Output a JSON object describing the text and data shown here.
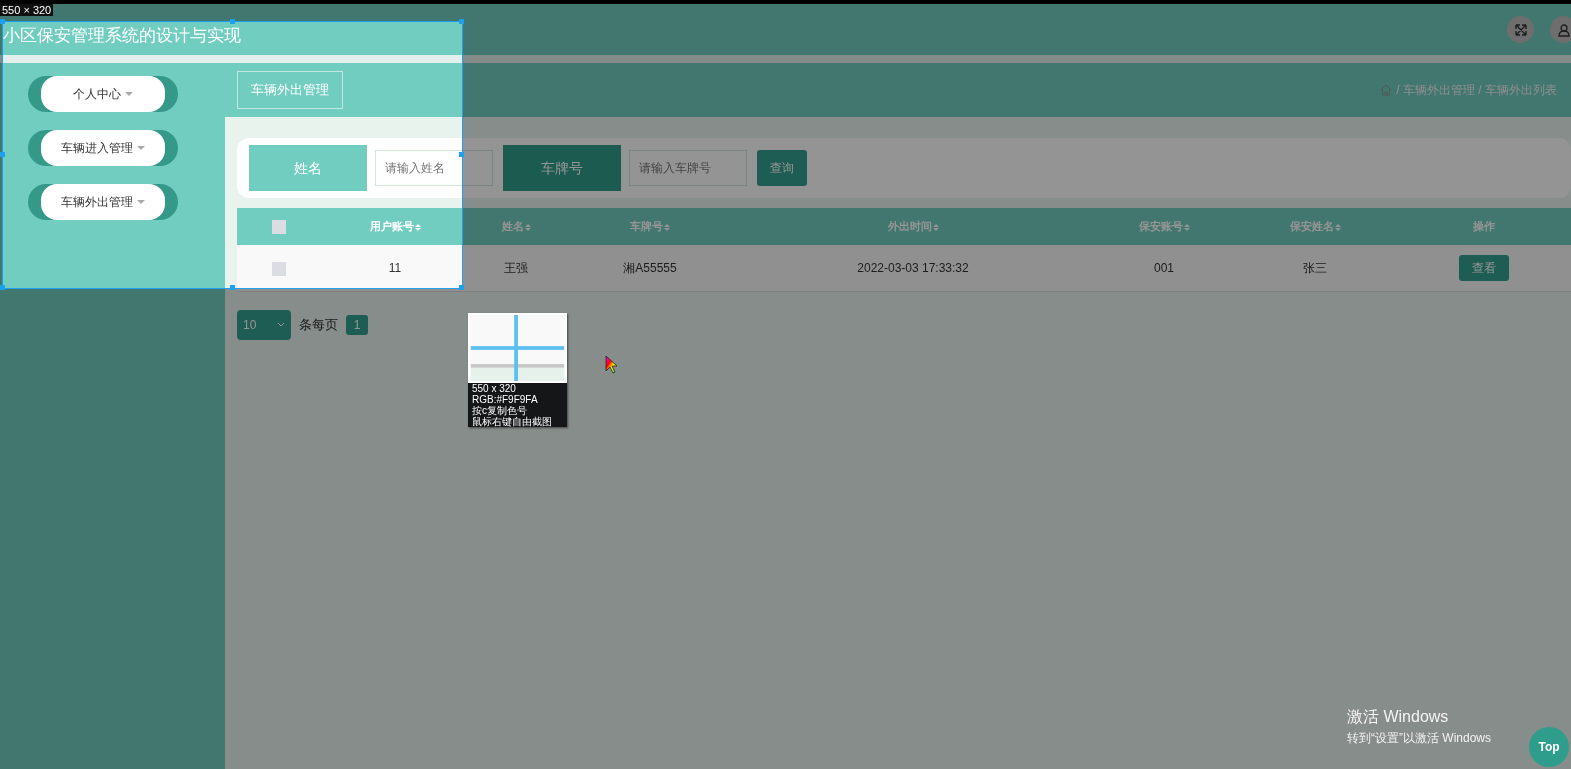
{
  "header": {
    "title": "小区保安管理系统的设计与实现"
  },
  "sidebar": {
    "items": [
      {
        "label": "个人中心"
      },
      {
        "label": "车辆进入管理"
      },
      {
        "label": "车辆外出管理"
      }
    ]
  },
  "tab": {
    "label": "车辆外出管理"
  },
  "breadcrumb": "/ 车辆外出管理 / 车辆外出列表",
  "search": {
    "fields": [
      {
        "label": "姓名",
        "placeholder": "请输入姓名",
        "kind": "light"
      },
      {
        "label": "车牌号",
        "placeholder": "请输入车牌号",
        "kind": "dark"
      }
    ],
    "button": "查询"
  },
  "table": {
    "select_all_checked": false,
    "columns": [
      {
        "label": "用户账号",
        "sortable": true
      },
      {
        "label": "姓名",
        "sortable": true
      },
      {
        "label": "车牌号",
        "sortable": true
      },
      {
        "label": "外出时间",
        "sortable": true
      },
      {
        "label": "保安账号",
        "sortable": true
      },
      {
        "label": "保安姓名",
        "sortable": true
      },
      {
        "label": "操作",
        "sortable": false
      }
    ],
    "rows": [
      {
        "checked": false,
        "cells": [
          "11",
          "王强",
          "湘A55555",
          "2022-03-03 17:33:32",
          "001",
          "张三"
        ],
        "action": "查看"
      }
    ]
  },
  "pagination": {
    "page_size": "10",
    "page_size_label": "条每页",
    "pages": [
      {
        "label": "1",
        "selected": true
      }
    ]
  },
  "back_to_top": "Top",
  "os_notice": [
    "激活 Windows",
    "转到“设置”以激活 Windows"
  ],
  "screen_capture": {
    "size_label": "550 × 320",
    "magnifier": {
      "lines": [
        "550 x 320",
        "RGB:#F9F9FA",
        "按c复制色号",
        "鼠标右键自由截图"
      ]
    }
  }
}
